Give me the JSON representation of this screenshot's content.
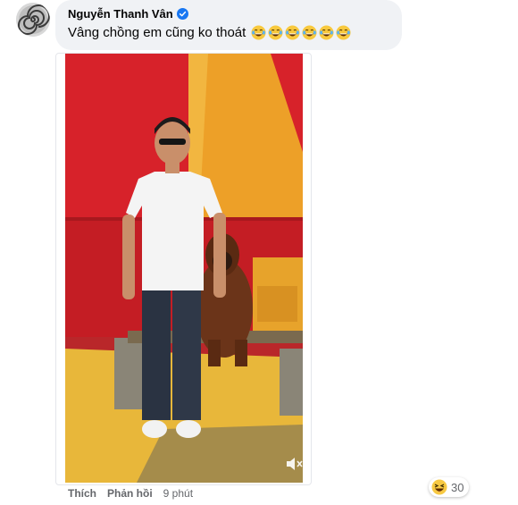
{
  "comment": {
    "author": "Nguyễn Thanh Vân",
    "text": "Vâng chồng em cũng ko thoát",
    "emoji_name": "laughing-tears-emoji",
    "emoji_count_in_text": 6
  },
  "media": {
    "type": "video"
  },
  "actions": {
    "like_label": "Thích",
    "reply_label": "Phản hồi",
    "timestamp": "9 phút"
  },
  "reactions": {
    "icon": "haha-reaction",
    "count": "30"
  },
  "colors": {
    "bubble_bg": "#f0f2f5",
    "verified_blue": "#1877f2",
    "meta_text": "#65676b"
  }
}
